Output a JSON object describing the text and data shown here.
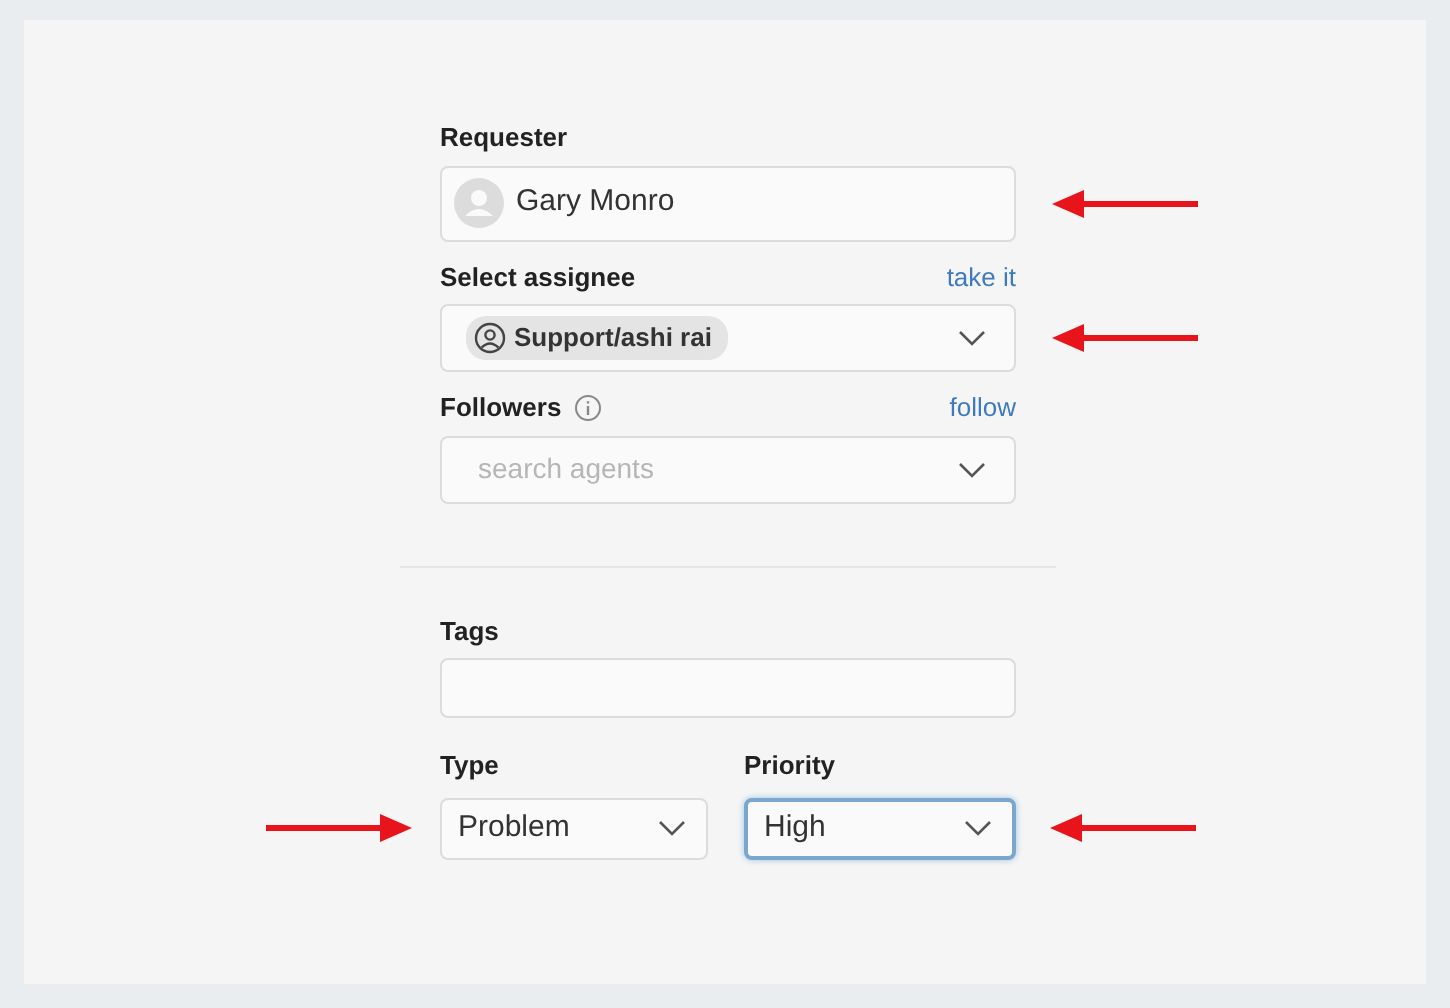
{
  "fields": [
    {
      "kind": "person",
      "label": "Requester",
      "value": "Gary Monro",
      "arrow_from_right": true
    },
    {
      "kind": "assignee",
      "label": "Select assignee",
      "link": "take it",
      "value": "Support/ashi rai",
      "arrow_from_right": true
    },
    {
      "kind": "search",
      "label": "Followers",
      "info": true,
      "link": "follow",
      "placeholder": "search agents"
    },
    {
      "kind": "divider"
    },
    {
      "kind": "text",
      "label": "Tags"
    }
  ],
  "selects": [
    {
      "label": "Type",
      "value": "Problem",
      "focused": false,
      "arrow_from_left": true
    },
    {
      "label": "Priority",
      "value": "High",
      "focused": true,
      "arrow_from_right": true
    }
  ]
}
